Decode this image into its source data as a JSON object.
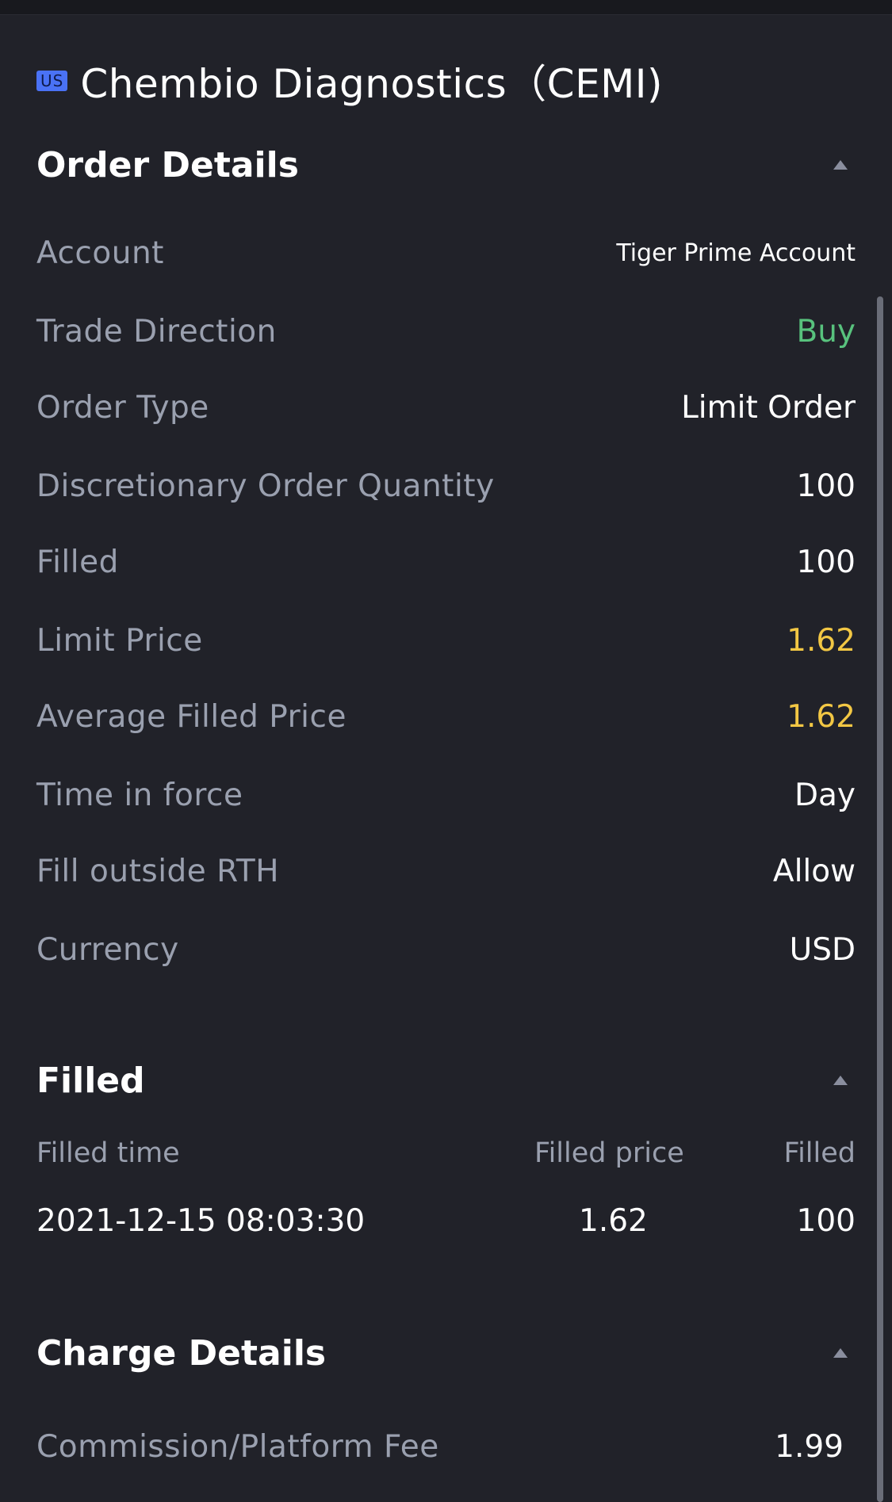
{
  "header": {
    "market_badge": "US",
    "stock_title": "Chembio Diagnostics（CEMI)"
  },
  "order_details": {
    "title": "Order Details",
    "rows": [
      {
        "label": "Account",
        "value": "Tiger Prime Account"
      },
      {
        "label": "Trade Direction",
        "value": "Buy"
      },
      {
        "label": "Order Type",
        "value": "Limit Order"
      },
      {
        "label": "Discretionary Order Quantity",
        "value": "100"
      },
      {
        "label": "Filled",
        "value": "100"
      },
      {
        "label": "Limit Price",
        "value": "1.62"
      },
      {
        "label": "Average Filled Price",
        "value": "1.62"
      },
      {
        "label": "Time in force",
        "value": "Day"
      },
      {
        "label": "Fill outside RTH",
        "value": "Allow"
      },
      {
        "label": "Currency",
        "value": "USD"
      }
    ]
  },
  "filled": {
    "title": "Filled",
    "columns": [
      "Filled time",
      "Filled price",
      "Filled"
    ],
    "rows": [
      [
        "2021-12-15 08:03:30",
        "1.62",
        "100"
      ]
    ]
  },
  "charge_details": {
    "title": "Charge Details",
    "rows": [
      {
        "label": "Commission/Platform Fee",
        "value": "1.99"
      }
    ]
  },
  "colors": {
    "background": "#212229",
    "buy": "#58c27d",
    "price": "#f2c744",
    "label": "#9aa0af",
    "badge": "#4a72f5"
  }
}
